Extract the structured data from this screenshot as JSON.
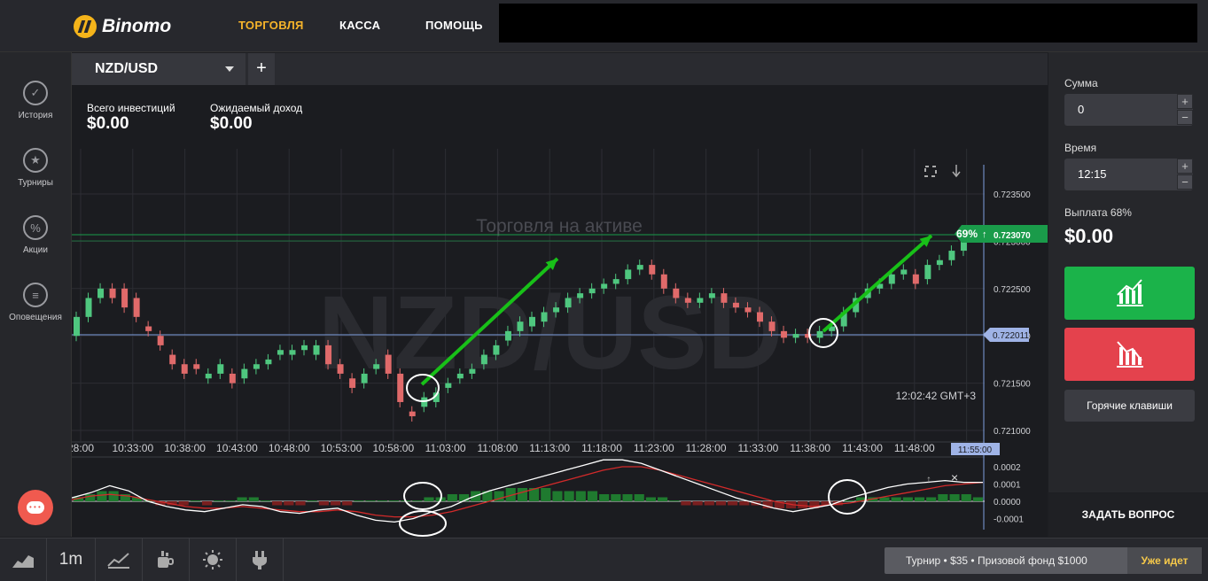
{
  "app": {
    "logo_text": "Binomo"
  },
  "nav": {
    "items": [
      "ТОРГОВЛЯ",
      "КАССА",
      "ПОМОЩЬ"
    ],
    "active": 0
  },
  "sidebar": {
    "items": [
      {
        "label": "История",
        "icon": "check-circle-icon"
      },
      {
        "label": "Турниры",
        "icon": "trophy-icon"
      },
      {
        "label": "Акции",
        "icon": "percent-icon"
      },
      {
        "label": "Оповещения",
        "icon": "list-icon"
      }
    ]
  },
  "asset_tab": {
    "name": "NZD/USD",
    "add_label": "+"
  },
  "investments": {
    "total_label": "Всего инвестиций",
    "total_value": "$0.00",
    "expected_label": "Ожидаемый доход",
    "expected_value": "$0.00"
  },
  "chart": {
    "watermark": "NZD/USD",
    "overlay_text": "Торговля на активе",
    "server_time": "12:02:42 GMT+3",
    "expiry_label": "11:55:00",
    "y_ticks": [
      "0.723500",
      "0.723000",
      "0.722500",
      "0.722000",
      "0.721500",
      "0.721000"
    ],
    "x_ticks": [
      "28:00",
      "10:33:00",
      "10:38:00",
      "10:43:00",
      "10:48:00",
      "10:53:00",
      "10:58:00",
      "11:03:00",
      "11:08:00",
      "11:13:00",
      "11:18:00",
      "11:23:00",
      "11:28:00",
      "11:33:00",
      "11:38:00",
      "11:43:00",
      "11:48:00",
      "11"
    ],
    "payout_badge": "69%",
    "target_price": "0.723070",
    "current_price": "0.722011",
    "osc_ticks": [
      "0.0002",
      "0.0001",
      "0.0000",
      "-0.0001"
    ],
    "colors": {
      "up": "#4fc77f",
      "down": "#e06a6a",
      "target": "#1a9b4a",
      "current": "#9fb3e6",
      "arrow": "#18c018"
    }
  },
  "chart_data": {
    "type": "candlestick",
    "y_range": [
      0.72095,
      0.72365
    ],
    "candles": [
      [
        0.722,
        0.7222
      ],
      [
        0.7222,
        0.7224
      ],
      [
        0.7224,
        0.7225
      ],
      [
        0.7225,
        0.7224
      ],
      [
        0.7225,
        0.7223
      ],
      [
        0.7224,
        0.7222
      ],
      [
        0.7221,
        0.72205
      ],
      [
        0.722,
        0.7219
      ],
      [
        0.7218,
        0.7217
      ],
      [
        0.7217,
        0.7216
      ],
      [
        0.7217,
        0.72165
      ],
      [
        0.72155,
        0.7216
      ],
      [
        0.7216,
        0.7217
      ],
      [
        0.7216,
        0.7215
      ],
      [
        0.72155,
        0.72165
      ],
      [
        0.72165,
        0.7217
      ],
      [
        0.7217,
        0.72175
      ],
      [
        0.7218,
        0.72185
      ],
      [
        0.7218,
        0.72185
      ],
      [
        0.72185,
        0.7219
      ],
      [
        0.7218,
        0.7219
      ],
      [
        0.7219,
        0.7217
      ],
      [
        0.7217,
        0.7216
      ],
      [
        0.72155,
        0.72145
      ],
      [
        0.7215,
        0.7216
      ],
      [
        0.72165,
        0.7217
      ],
      [
        0.7218,
        0.7216
      ],
      [
        0.7216,
        0.7213
      ],
      [
        0.7212,
        0.72115
      ],
      [
        0.72125,
        0.72135
      ],
      [
        0.7213,
        0.7214
      ],
      [
        0.72145,
        0.7215
      ],
      [
        0.72155,
        0.7216
      ],
      [
        0.7216,
        0.72165
      ],
      [
        0.7217,
        0.7218
      ],
      [
        0.7218,
        0.7219
      ],
      [
        0.72195,
        0.72205
      ],
      [
        0.72205,
        0.72215
      ],
      [
        0.7221,
        0.7222
      ],
      [
        0.72215,
        0.72225
      ],
      [
        0.72225,
        0.7223
      ],
      [
        0.7223,
        0.7224
      ],
      [
        0.7224,
        0.72245
      ],
      [
        0.72245,
        0.7225
      ],
      [
        0.7225,
        0.72255
      ],
      [
        0.72255,
        0.7226
      ],
      [
        0.7226,
        0.7227
      ],
      [
        0.7227,
        0.72275
      ],
      [
        0.72275,
        0.72265
      ],
      [
        0.72265,
        0.7225
      ],
      [
        0.7225,
        0.7224
      ],
      [
        0.7224,
        0.72235
      ],
      [
        0.72235,
        0.7224
      ],
      [
        0.7224,
        0.72245
      ],
      [
        0.72245,
        0.72235
      ],
      [
        0.72235,
        0.7223
      ],
      [
        0.7223,
        0.72225
      ],
      [
        0.72225,
        0.72215
      ],
      [
        0.72215,
        0.72205
      ],
      [
        0.72205,
        0.72198
      ],
      [
        0.72198,
        0.72202
      ],
      [
        0.72202,
        0.72198
      ],
      [
        0.72198,
        0.72205
      ],
      [
        0.72205,
        0.7221
      ],
      [
        0.7221,
        0.72225
      ],
      [
        0.72225,
        0.7224
      ],
      [
        0.7224,
        0.7225
      ],
      [
        0.7225,
        0.72255
      ],
      [
        0.72255,
        0.72265
      ],
      [
        0.72265,
        0.7227
      ],
      [
        0.72265,
        0.72255
      ],
      [
        0.7226,
        0.72275
      ],
      [
        0.72275,
        0.7228
      ],
      [
        0.7228,
        0.7229
      ],
      [
        0.7229,
        0.723
      ]
    ],
    "histogram": [
      1,
      2,
      3,
      3,
      2,
      1,
      0,
      -1,
      -1,
      -1,
      0,
      -1,
      0,
      0,
      1,
      1,
      0,
      -1,
      -1,
      -1,
      0,
      -1,
      -1,
      -1,
      0,
      0,
      0,
      0,
      0,
      0,
      1,
      1,
      2,
      2,
      3,
      3,
      3,
      4,
      4,
      4,
      4,
      3,
      3,
      3,
      3,
      2,
      2,
      2,
      2,
      1,
      1,
      0,
      -1,
      -1,
      -1,
      -1,
      -1,
      -1,
      -1,
      -2,
      -2,
      -2,
      -2,
      -2,
      -1,
      -1,
      0,
      1,
      1,
      1,
      1,
      1,
      1,
      1,
      2,
      2,
      2,
      1
    ],
    "macd_line": [
      2e-05,
      5e-05,
      9e-05,
      6e-05,
      0.0,
      -3e-05,
      -5e-05,
      -6e-05,
      -4e-05,
      -2e-05,
      -3e-05,
      -6e-05,
      -7e-05,
      -5e-05,
      -4e-05,
      -8e-05,
      -0.00011,
      -0.00012,
      -0.0001,
      -6e-05,
      -3e-05,
      2e-05,
      6e-05,
      9e-05,
      0.00012,
      0.00015,
      0.00018,
      0.00021,
      0.00024,
      0.00024,
      0.00022,
      0.00018,
      0.00014,
      0.0001,
      6e-05,
      2e-05,
      -1e-05,
      -4e-05,
      -6e-05,
      -4e-05,
      -2e-05,
      2e-05,
      5e-05,
      8e-05,
      0.0001,
      0.00011,
      0.00012,
      0.00011,
      0.00011
    ],
    "signal_line": [
      1e-05,
      3e-05,
      4e-05,
      3e-05,
      1e-05,
      -1e-05,
      -3e-05,
      -4e-05,
      -4e-05,
      -3e-05,
      -4e-05,
      -5e-05,
      -6e-05,
      -6e-05,
      -5e-05,
      -6e-05,
      -8e-05,
      -9e-05,
      -9e-05,
      -8e-05,
      -6e-05,
      -3e-05,
      0.0,
      3e-05,
      6e-05,
      9e-05,
      0.00012,
      0.00015,
      0.00018,
      0.0002,
      0.0002,
      0.00018,
      0.00015,
      0.00012,
      9e-05,
      6e-05,
      3e-05,
      0.0,
      -2e-05,
      -3e-05,
      -2e-05,
      -1e-05,
      1e-05,
      3e-05,
      5e-05,
      7e-05,
      9e-05,
      0.0001,
      0.00011
    ]
  },
  "right_panel": {
    "amount_label": "Сумма",
    "amount_value": "0",
    "time_label": "Время",
    "time_value": "12:15",
    "payout_label": "Выплата 68%",
    "payout_value": "$0.00",
    "hotkeys_label": "Горячие клавиши",
    "plus": "+",
    "minus": "−"
  },
  "ask_label": "ЗАДАТЬ ВОПРОС",
  "bottom": {
    "timeframe": "1m",
    "tournament_text": "Турнир • $35 • Призовой фонд $1000",
    "tournament_badge": "Уже идет"
  }
}
